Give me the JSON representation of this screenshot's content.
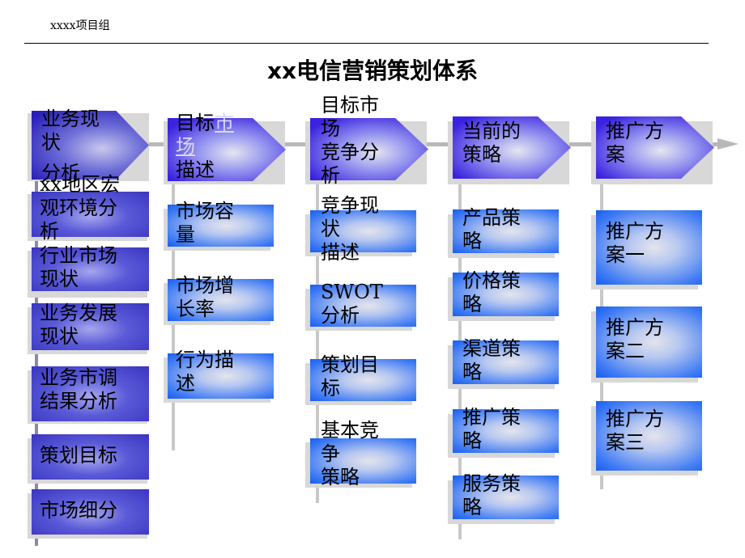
{
  "header": {
    "label": "xxxx项目组"
  },
  "title": "xx电信营销策划体系",
  "columns": [
    {
      "header": {
        "line1": "业务现\n状",
        "line2": "分析"
      },
      "items": [
        "xx地区宏\n观环境分\n析",
        "行业市场\n现状",
        "业务发展\n现状",
        "业务市调\n结果分析",
        "策划目标",
        "市场细分"
      ]
    },
    {
      "header": {
        "pre": "目标",
        "link": "市\n场",
        "post": "\n描述"
      },
      "items": [
        "市场容\n量",
        "市场增\n长率",
        "行为描\n述"
      ]
    },
    {
      "header": {
        "text": "目标市\n场\n竞争分\n析"
      },
      "items": [
        "竞争现\n状\n描述",
        "SWOT\n分析",
        "策划目\n标",
        "基本竞\n争\n策略"
      ]
    },
    {
      "header": {
        "text": "当前的\n策略"
      },
      "items": [
        "产品策\n略",
        "价格策\n略",
        "渠道策\n略",
        "推广策\n略",
        "服务策\n略"
      ]
    },
    {
      "header": {
        "text": "推广方\n案"
      },
      "items": [
        "推广方\n案一",
        "推广方\n案二",
        "推广方\n案三"
      ]
    }
  ],
  "colors": {
    "chevron": "#3a22e0",
    "purple_box": "#3a35c0",
    "blue_box": "#1a5ef0",
    "connector": "#b8b8b8"
  }
}
